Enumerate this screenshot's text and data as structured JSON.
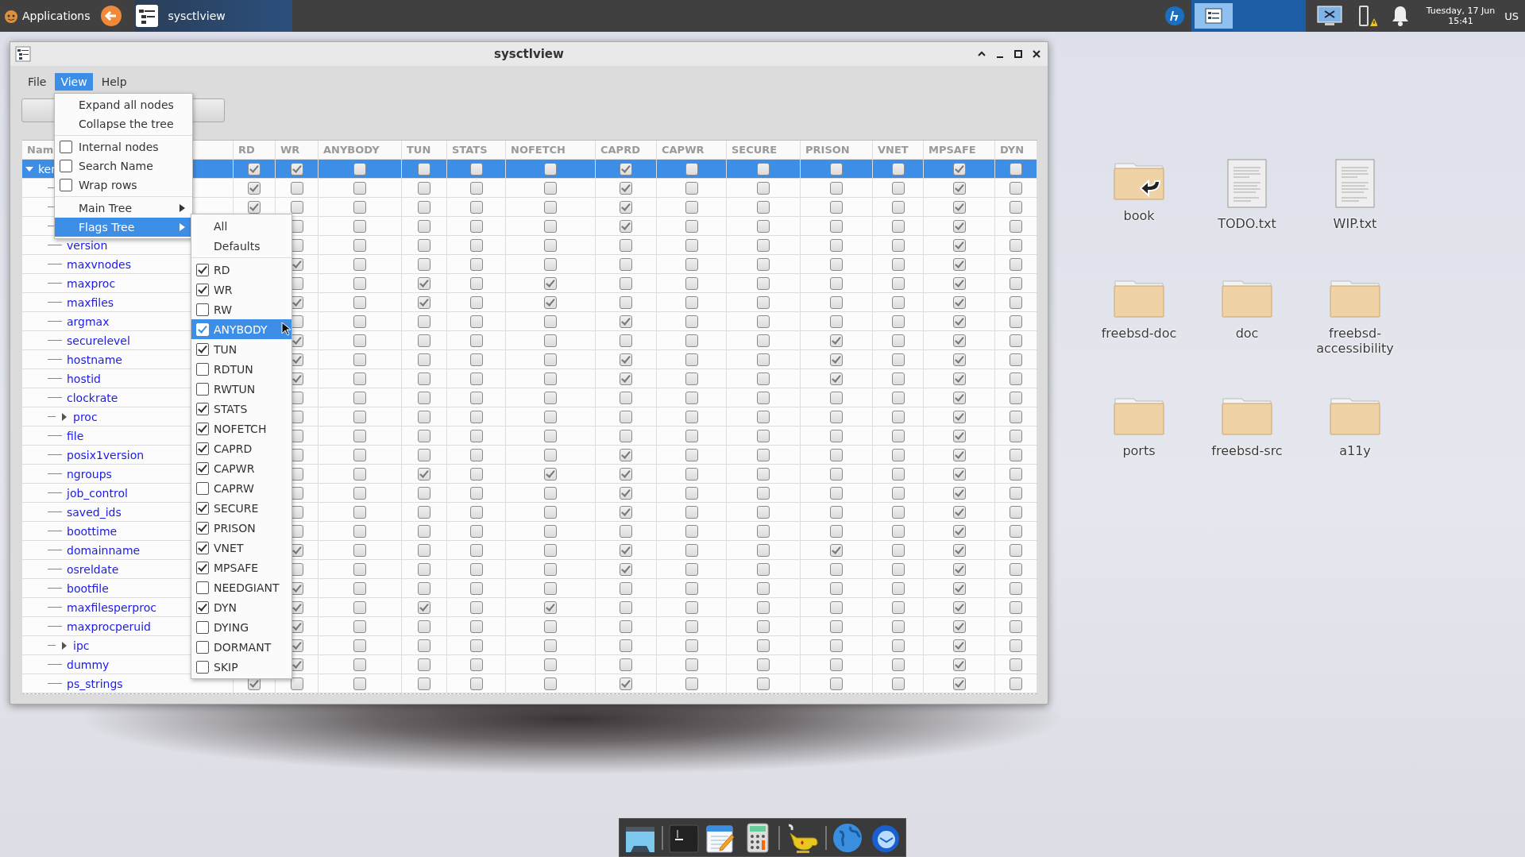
{
  "taskbar": {
    "apps_label": "Applications",
    "tasks": [
      {
        "label": "sysctlview",
        "selected": true
      }
    ],
    "clock_date": "Tuesday, 17 Jun",
    "clock_time": "15:41",
    "keyboard_layout": "US"
  },
  "window": {
    "title": "sysctlview",
    "menubar": [
      {
        "label": "File",
        "selected": false
      },
      {
        "label": "View",
        "selected": true
      },
      {
        "label": "Help",
        "selected": false
      }
    ],
    "view_menu": [
      {
        "kind": "action",
        "label": "Expand all nodes",
        "selected": false
      },
      {
        "kind": "action",
        "label": "Collapse the tree",
        "selected": false
      },
      {
        "kind": "separator"
      },
      {
        "kind": "check",
        "label": "Internal nodes",
        "checked": false,
        "selected": false
      },
      {
        "kind": "check",
        "label": "Search Name",
        "checked": false,
        "selected": false
      },
      {
        "kind": "check",
        "label": "Wrap rows",
        "checked": false,
        "selected": false
      },
      {
        "kind": "separator"
      },
      {
        "kind": "submenu",
        "label": "Main Tree",
        "selected": false
      },
      {
        "kind": "submenu",
        "label": "Flags Tree",
        "selected": true
      }
    ],
    "flags_menu": [
      {
        "kind": "action",
        "label": "All",
        "selected": false
      },
      {
        "kind": "action",
        "label": "Defaults",
        "selected": false
      },
      {
        "kind": "separator"
      },
      {
        "kind": "check",
        "label": "RD",
        "checked": true,
        "selected": false
      },
      {
        "kind": "check",
        "label": "WR",
        "checked": true,
        "selected": false
      },
      {
        "kind": "check",
        "label": "RW",
        "checked": false,
        "selected": false
      },
      {
        "kind": "check",
        "label": "ANYBODY",
        "checked": true,
        "selected": true
      },
      {
        "kind": "check",
        "label": "TUN",
        "checked": true,
        "selected": false
      },
      {
        "kind": "check",
        "label": "RDTUN",
        "checked": false,
        "selected": false
      },
      {
        "kind": "check",
        "label": "RWTUN",
        "checked": false,
        "selected": false
      },
      {
        "kind": "check",
        "label": "STATS",
        "checked": true,
        "selected": false
      },
      {
        "kind": "check",
        "label": "NOFETCH",
        "checked": true,
        "selected": false
      },
      {
        "kind": "check",
        "label": "CAPRD",
        "checked": true,
        "selected": false
      },
      {
        "kind": "check",
        "label": "CAPWR",
        "checked": true,
        "selected": false
      },
      {
        "kind": "check",
        "label": "CAPRW",
        "checked": false,
        "selected": false
      },
      {
        "kind": "check",
        "label": "SECURE",
        "checked": true,
        "selected": false
      },
      {
        "kind": "check",
        "label": "PRISON",
        "checked": true,
        "selected": false
      },
      {
        "kind": "check",
        "label": "VNET",
        "checked": true,
        "selected": false
      },
      {
        "kind": "check",
        "label": "MPSAFE",
        "checked": true,
        "selected": false
      },
      {
        "kind": "check",
        "label": "NEEDGIANT",
        "checked": false,
        "selected": false
      },
      {
        "kind": "check",
        "label": "DYN",
        "checked": true,
        "selected": false
      },
      {
        "kind": "check",
        "label": "DYING",
        "checked": false,
        "selected": false
      },
      {
        "kind": "check",
        "label": "DORMANT",
        "checked": false,
        "selected": false
      },
      {
        "kind": "check",
        "label": "SKIP",
        "checked": false,
        "selected": false
      }
    ],
    "table": {
      "columns": [
        "Nam",
        "RD",
        "WR",
        "ANYBODY",
        "TUN",
        "STATS",
        "NOFETCH",
        "CAPRD",
        "CAPWR",
        "SECURE",
        "PRISON",
        "VNET",
        "MPSAFE",
        "DYN"
      ],
      "rows": [
        {
          "name": "ker",
          "expanded": true,
          "selected": true,
          "cells": [
            true,
            true,
            false,
            false,
            false,
            false,
            true,
            false,
            false,
            false,
            false,
            true,
            false
          ],
          "children": [
            {
              "selected": false,
              "cells": [
                true,
                false,
                false,
                false,
                false,
                false,
                true,
                false,
                false,
                false,
                false,
                true,
                false
              ]
            },
            {
              "selected": false,
              "cells": [
                true,
                false,
                false,
                false,
                false,
                false,
                true,
                false,
                false,
                false,
                false,
                true,
                false
              ]
            },
            {
              "selected": false,
              "cells": [
                null,
                false,
                false,
                false,
                false,
                false,
                true,
                false,
                false,
                false,
                false,
                true,
                false
              ]
            },
            {
              "name": "version",
              "selected": false,
              "cells": [
                null,
                false,
                false,
                false,
                false,
                false,
                false,
                false,
                false,
                false,
                false,
                true,
                false
              ]
            },
            {
              "name": "maxvnodes",
              "selected": false,
              "cells": [
                null,
                true,
                false,
                false,
                false,
                false,
                false,
                false,
                false,
                false,
                false,
                true,
                false
              ]
            },
            {
              "name": "maxproc",
              "selected": false,
              "cells": [
                null,
                false,
                false,
                true,
                false,
                true,
                false,
                false,
                false,
                false,
                false,
                true,
                false
              ]
            },
            {
              "name": "maxfiles",
              "selected": false,
              "cells": [
                null,
                true,
                false,
                true,
                false,
                true,
                false,
                false,
                false,
                false,
                false,
                true,
                false
              ]
            },
            {
              "name": "argmax",
              "selected": false,
              "cells": [
                null,
                false,
                false,
                false,
                false,
                false,
                true,
                false,
                false,
                false,
                false,
                true,
                false
              ]
            },
            {
              "name": "securelevel",
              "selected": false,
              "cells": [
                null,
                true,
                false,
                false,
                false,
                false,
                false,
                false,
                false,
                true,
                false,
                true,
                false
              ]
            },
            {
              "name": "hostname",
              "selected": false,
              "cells": [
                null,
                true,
                false,
                false,
                false,
                false,
                true,
                false,
                false,
                true,
                false,
                true,
                false
              ]
            },
            {
              "name": "hostid",
              "selected": false,
              "cells": [
                null,
                true,
                false,
                false,
                false,
                false,
                true,
                false,
                false,
                true,
                false,
                true,
                false
              ]
            },
            {
              "name": "clockrate",
              "selected": false,
              "cells": [
                null,
                false,
                false,
                false,
                false,
                false,
                false,
                false,
                false,
                false,
                false,
                true,
                false
              ]
            },
            {
              "name": "proc",
              "expanded": false,
              "selected": false,
              "cells": [
                null,
                false,
                false,
                false,
                false,
                false,
                false,
                false,
                false,
                false,
                false,
                true,
                false
              ]
            },
            {
              "name": "file",
              "selected": false,
              "cells": [
                null,
                false,
                false,
                false,
                false,
                false,
                false,
                false,
                false,
                false,
                false,
                true,
                false
              ]
            },
            {
              "name": "posix1version",
              "selected": false,
              "cells": [
                null,
                false,
                false,
                false,
                false,
                false,
                true,
                false,
                false,
                false,
                false,
                true,
                false
              ]
            },
            {
              "name": "ngroups",
              "selected": false,
              "cells": [
                null,
                false,
                false,
                true,
                false,
                true,
                true,
                false,
                false,
                false,
                false,
                true,
                false
              ]
            },
            {
              "name": "job_control",
              "selected": false,
              "cells": [
                null,
                false,
                false,
                false,
                false,
                false,
                true,
                false,
                false,
                false,
                false,
                true,
                false
              ]
            },
            {
              "name": "saved_ids",
              "selected": false,
              "cells": [
                null,
                false,
                false,
                false,
                false,
                false,
                true,
                false,
                false,
                false,
                false,
                true,
                false
              ]
            },
            {
              "name": "boottime",
              "selected": false,
              "cells": [
                null,
                false,
                false,
                false,
                false,
                false,
                false,
                false,
                false,
                false,
                false,
                true,
                false
              ]
            },
            {
              "name": "domainname",
              "selected": false,
              "cells": [
                null,
                true,
                false,
                false,
                false,
                false,
                true,
                false,
                false,
                true,
                false,
                true,
                false
              ]
            },
            {
              "name": "osreldate",
              "selected": false,
              "cells": [
                null,
                false,
                false,
                false,
                false,
                false,
                true,
                false,
                false,
                false,
                false,
                true,
                false
              ]
            },
            {
              "name": "bootfile",
              "selected": false,
              "cells": [
                null,
                true,
                false,
                false,
                false,
                false,
                false,
                false,
                false,
                false,
                false,
                true,
                false
              ]
            },
            {
              "name": "maxfilesperproc",
              "selected": false,
              "cells": [
                null,
                true,
                false,
                true,
                false,
                true,
                false,
                false,
                false,
                false,
                false,
                true,
                false
              ]
            },
            {
              "name": "maxprocperuid",
              "selected": false,
              "cells": [
                null,
                true,
                false,
                false,
                false,
                false,
                false,
                false,
                false,
                false,
                false,
                true,
                false
              ]
            },
            {
              "name": "ipc",
              "expanded": false,
              "selected": false,
              "cells": [
                null,
                true,
                false,
                false,
                false,
                false,
                false,
                false,
                false,
                false,
                false,
                true,
                false
              ]
            },
            {
              "name": "dummy",
              "selected": false,
              "cells": [
                null,
                true,
                false,
                false,
                false,
                false,
                false,
                false,
                false,
                false,
                false,
                true,
                false
              ]
            },
            {
              "name": "ps_strings",
              "selected": false,
              "cells": [
                true,
                false,
                false,
                false,
                false,
                false,
                true,
                false,
                false,
                false,
                false,
                true,
                false
              ]
            }
          ]
        }
      ]
    }
  },
  "desktop_icons": [
    {
      "label": "book",
      "kind": "link-folder"
    },
    {
      "label": "TODO.txt",
      "kind": "text-file"
    },
    {
      "label": "WIP.txt",
      "kind": "text-file"
    },
    {
      "label": "freebsd-doc",
      "kind": "folder"
    },
    {
      "label": "doc",
      "kind": "folder"
    },
    {
      "label": "freebsd-accessibility",
      "kind": "folder"
    },
    {
      "label": "ports",
      "kind": "folder"
    },
    {
      "label": "freebsd-src",
      "kind": "folder"
    },
    {
      "label": "a11y",
      "kind": "folder"
    }
  ]
}
